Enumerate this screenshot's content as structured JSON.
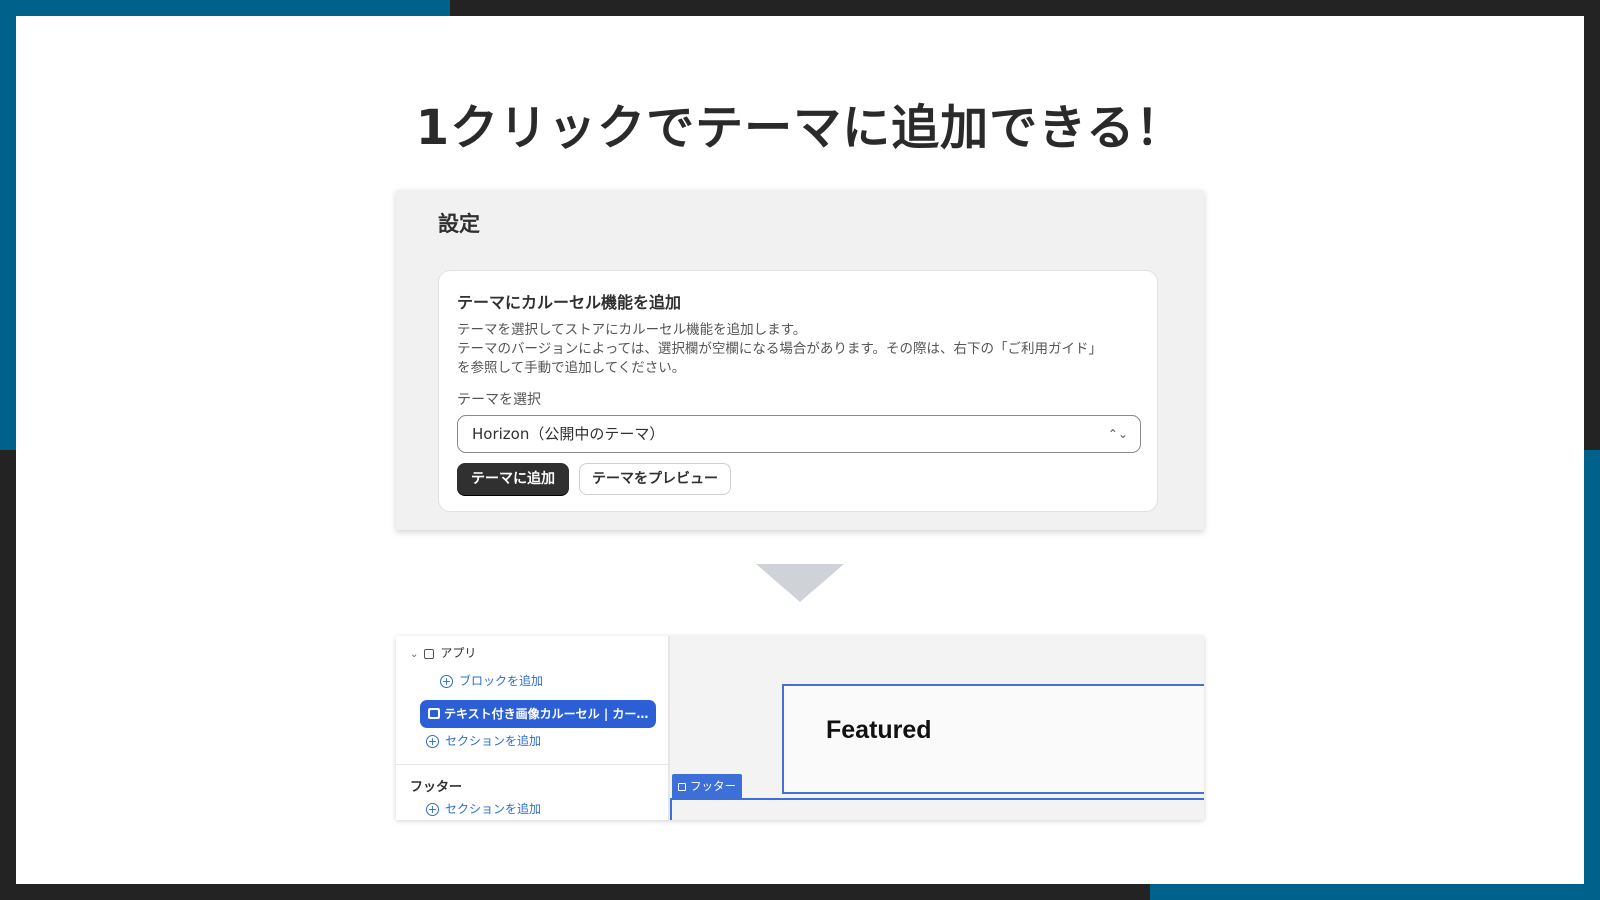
{
  "headline": "1クリックでテーマに追加できる！",
  "settings": {
    "title": "設定",
    "card": {
      "title": "テーマにカルーセル機能を追加",
      "description": "テーマを選択してストアにカルーセル機能を追加します。\nテーマのバージョンによっては、選択欄が空欄になる場合があります。その際は、右下の「ご利用ガイド」\nを参照して手動で追加してください。",
      "select_label": "テーマを選択",
      "select_value": "Horizon（公開中のテーマ）",
      "add_button": "テーマに追加",
      "preview_button": "テーマをプレビュー"
    }
  },
  "editor": {
    "apps_label": "アプリ",
    "add_block": "ブロックを追加",
    "selected_block": "テキスト付き画像カルーセル | カー…",
    "add_section": "セクションを追加",
    "footer_heading": "フッター",
    "footer_add_section": "セクションを追加",
    "preview_featured": "Featured",
    "footer_tag": "フッター"
  },
  "colors": {
    "accent_frame": "#00628a",
    "dark_frame": "#232323",
    "selected_block": "#2c5fd6",
    "link": "#2c6ecb"
  },
  "icons": [
    "chevron-down-icon",
    "section-grid-icon",
    "add-circle-icon",
    "image-icon",
    "down-arrow-icon"
  ]
}
